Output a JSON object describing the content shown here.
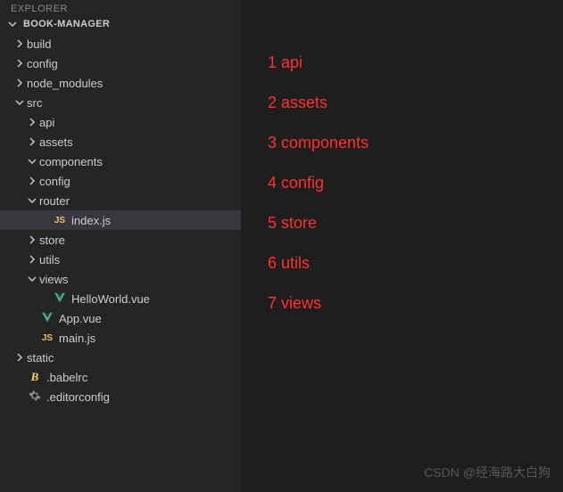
{
  "explorer": {
    "label": "EXPLORER"
  },
  "root": {
    "name": "BOOK-MANAGER"
  },
  "tree": [
    {
      "id": "build",
      "label": "build",
      "depth": 0,
      "kind": "folder",
      "state": "closed"
    },
    {
      "id": "config",
      "label": "config",
      "depth": 0,
      "kind": "folder",
      "state": "closed"
    },
    {
      "id": "node_modules",
      "label": "node_modules",
      "depth": 0,
      "kind": "folder",
      "state": "closed"
    },
    {
      "id": "src",
      "label": "src",
      "depth": 0,
      "kind": "folder",
      "state": "open"
    },
    {
      "id": "api",
      "label": "api",
      "depth": 1,
      "kind": "folder",
      "state": "closed"
    },
    {
      "id": "assets",
      "label": "assets",
      "depth": 1,
      "kind": "folder",
      "state": "closed"
    },
    {
      "id": "components",
      "label": "components",
      "depth": 1,
      "kind": "folder",
      "state": "open"
    },
    {
      "id": "config2",
      "label": "config",
      "depth": 1,
      "kind": "folder",
      "state": "closed"
    },
    {
      "id": "router",
      "label": "router",
      "depth": 1,
      "kind": "folder",
      "state": "open"
    },
    {
      "id": "indexjs",
      "label": "index.js",
      "depth": 2,
      "kind": "file",
      "icon": "js",
      "selected": true
    },
    {
      "id": "store",
      "label": "store",
      "depth": 1,
      "kind": "folder",
      "state": "closed"
    },
    {
      "id": "utils",
      "label": "utils",
      "depth": 1,
      "kind": "folder",
      "state": "closed"
    },
    {
      "id": "views",
      "label": "views",
      "depth": 1,
      "kind": "folder",
      "state": "open"
    },
    {
      "id": "hello",
      "label": "HelloWorld.vue",
      "depth": 2,
      "kind": "file",
      "icon": "vue"
    },
    {
      "id": "appvue",
      "label": "App.vue",
      "depth": 1,
      "kind": "file",
      "icon": "vue"
    },
    {
      "id": "mainjs",
      "label": "main.js",
      "depth": 1,
      "kind": "file",
      "icon": "js"
    },
    {
      "id": "static",
      "label": "static",
      "depth": 0,
      "kind": "folder",
      "state": "closed"
    },
    {
      "id": "babelrc",
      "label": ".babelrc",
      "depth": 0,
      "kind": "file",
      "icon": "babel"
    },
    {
      "id": "editorconfig",
      "label": ".editorconfig",
      "depth": 0,
      "kind": "file",
      "icon": "gear"
    }
  ],
  "annotations": [
    "1 api",
    "2 assets",
    "3 components",
    "4 config",
    "5 store",
    "6 utils",
    "7 views"
  ],
  "watermark": "CSDN @经海路大白狗"
}
